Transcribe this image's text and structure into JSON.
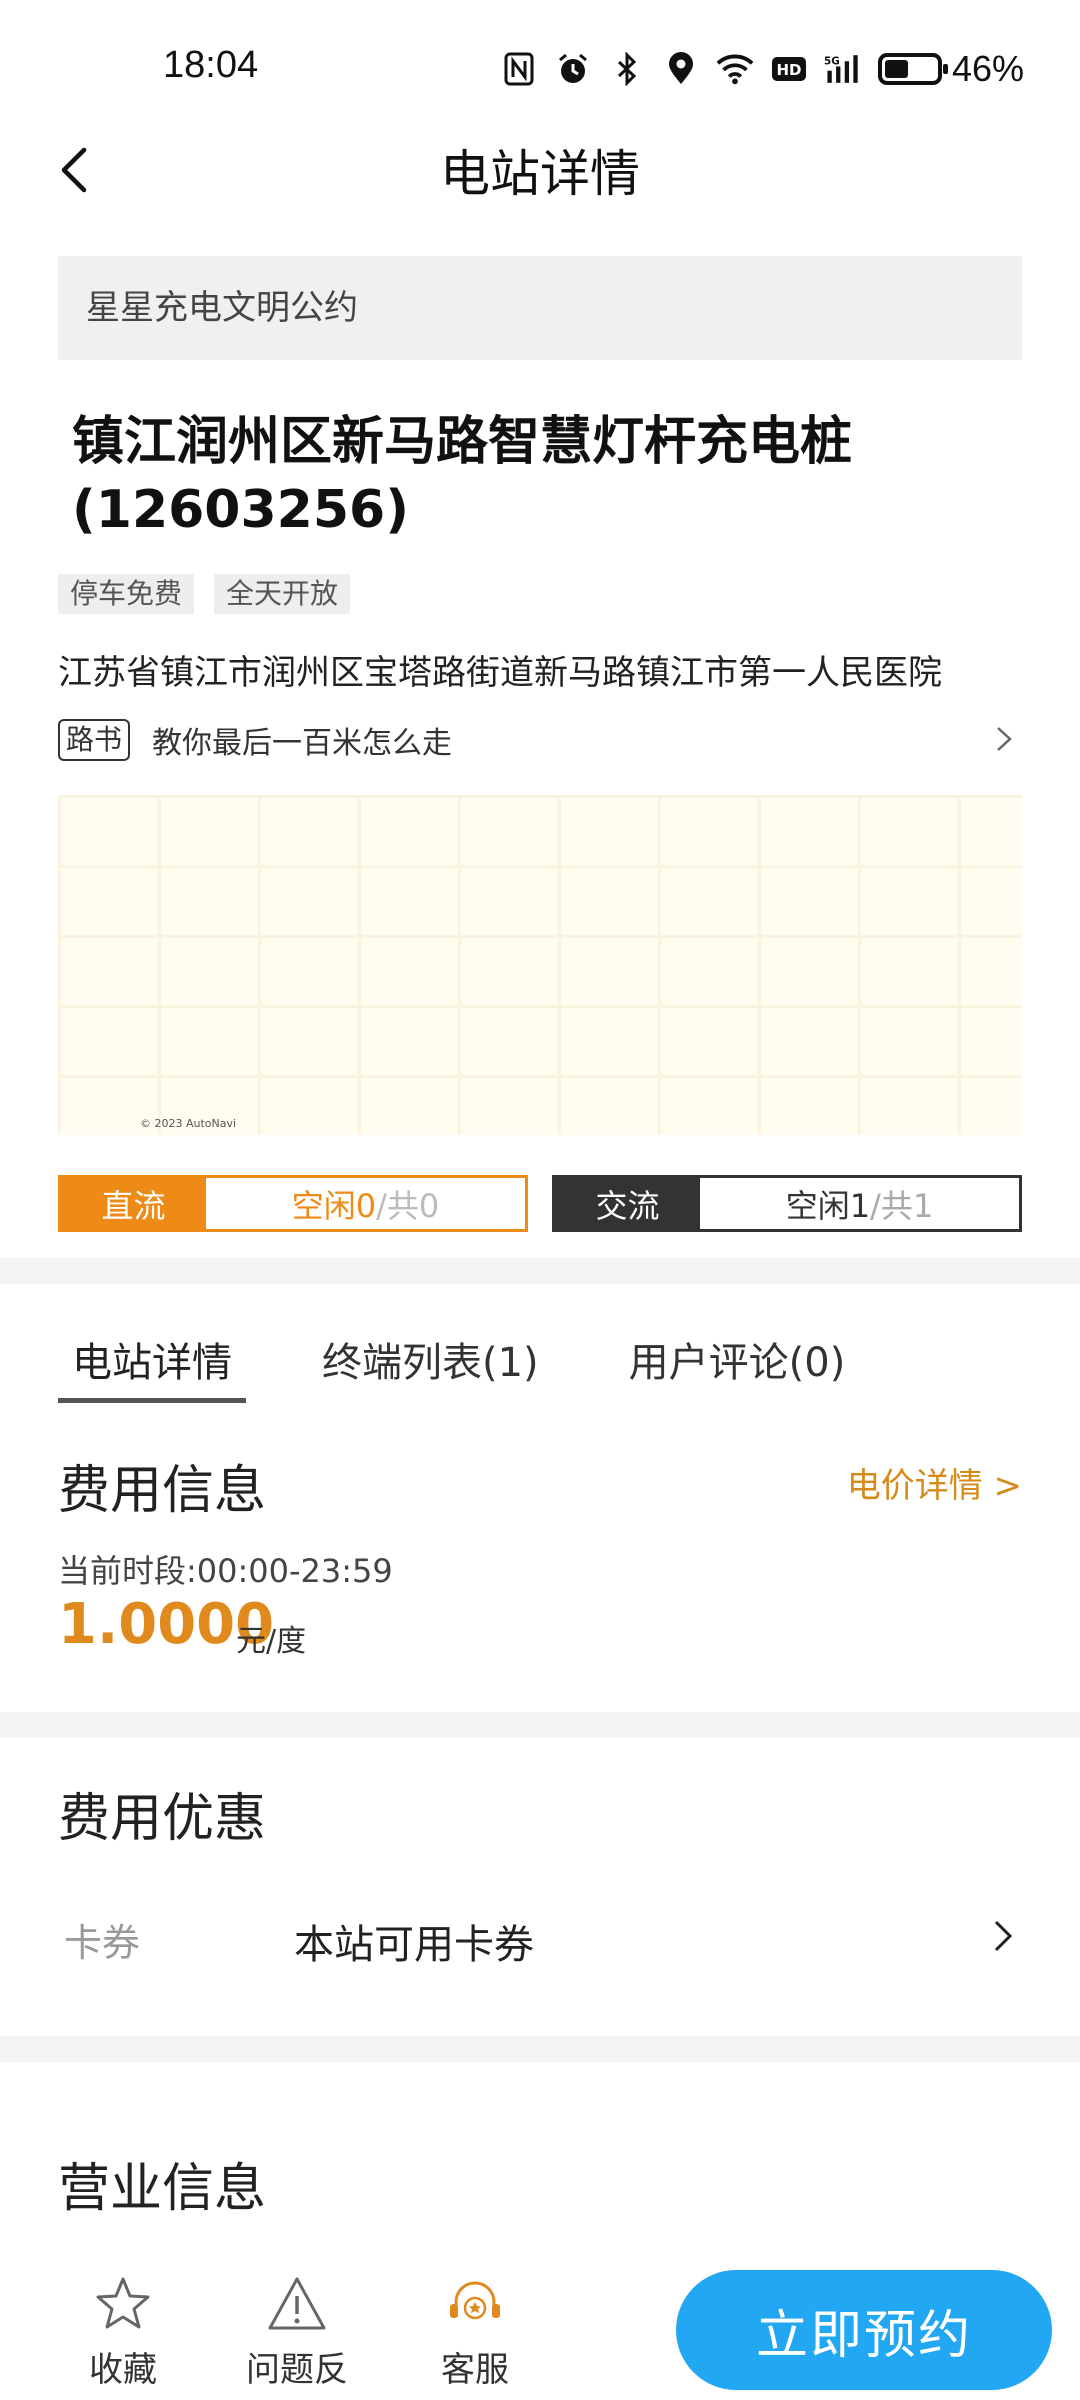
{
  "status": {
    "time": "18:04",
    "battery_percent": 46,
    "battery_text": "46%",
    "icons": [
      "nfc-icon",
      "alarm-icon",
      "bluetooth-icon",
      "location-icon",
      "wifi-icon",
      "hd-icon",
      "signal-5g-icon",
      "battery-icon"
    ]
  },
  "header": {
    "title": "电站详情"
  },
  "notice": "星星充电文明公约",
  "station": {
    "name_line1": "镇江润州区新马路智慧灯杆充电桩",
    "name_line2": "(12603256)",
    "tags": [
      "停车免费",
      "全天开放"
    ],
    "address": "江苏省镇江市润州区宝塔路街道新马路镇江市第一人民医院",
    "roadbook_badge": "路书",
    "roadbook_text": "教你最后一百米怎么走",
    "map_copyright": "© 2023 AutoNavi"
  },
  "availability": {
    "dc": {
      "label": "直流",
      "free_text": "空闲0",
      "total_text": "/共0"
    },
    "ac": {
      "label": "交流",
      "free_text": "空闲1",
      "total_text": "/共1"
    }
  },
  "tabs": [
    {
      "label": "电站详情",
      "active": true
    },
    {
      "label": "终端列表(1)",
      "active": false
    },
    {
      "label": "用户评论(0)",
      "active": false
    }
  ],
  "fee": {
    "title": "费用信息",
    "link": "电价详情 >",
    "period": "当前时段:00:00-23:59",
    "price": "1.0000",
    "unit": "元/度"
  },
  "discount": {
    "title": "费用优惠",
    "label": "卡券",
    "text": "本站可用卡券"
  },
  "business": {
    "title": "营业信息"
  },
  "bottom": {
    "favorite": "收藏",
    "feedback": "问题反馈",
    "service": "客服",
    "reserve": "立即预约"
  },
  "colors": {
    "accent_orange": "#ee8a16",
    "price_orange": "#e08a1e",
    "reserve_blue": "#22a7f2",
    "dark": "#333333"
  }
}
